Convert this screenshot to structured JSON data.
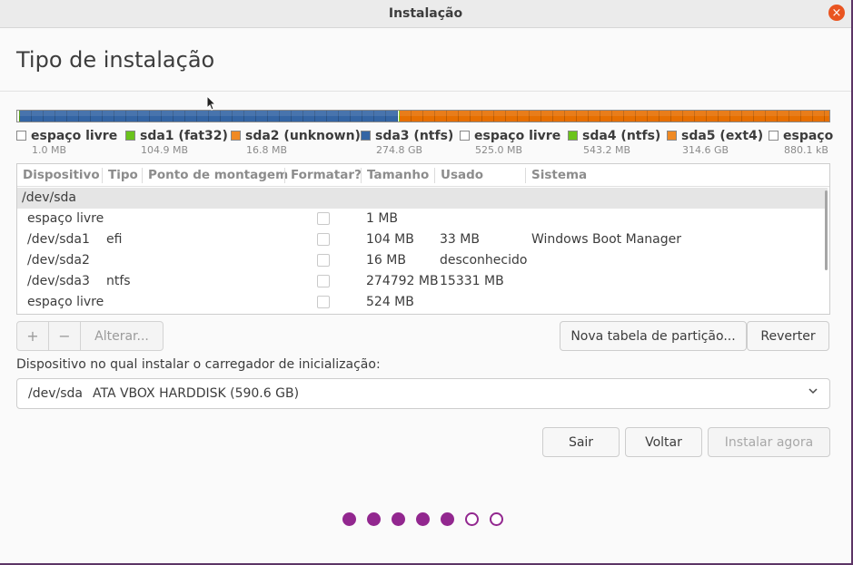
{
  "window": {
    "title": "Instalação",
    "close_icon": "×"
  },
  "heading": "Tipo de instalação",
  "partition_bar": {
    "segments": [
      {
        "name": "espaço livre",
        "color": "#ffffff",
        "fraction": 0.0017
      },
      {
        "name": "sda1",
        "color": "#4e9a06",
        "fraction": 0.0017
      },
      {
        "name": "sda2",
        "color": "#e66f00",
        "fraction": 0.0003
      },
      {
        "name": "sda3",
        "color": "#3465a4",
        "fraction": 0.4653
      },
      {
        "name": "espaço livre",
        "color": "#ffffff",
        "fraction": 0.0009
      },
      {
        "name": "sda4",
        "color": "#73d216",
        "fraction": 0.0009
      },
      {
        "name": "sda5",
        "color": "#e66f00",
        "fraction": 0.5292
      }
    ]
  },
  "legend": [
    {
      "label": "espaço livre",
      "size": "1.0 MB",
      "color": "#ffffff"
    },
    {
      "label": "sda1 (fat32)",
      "size": "104.9 MB",
      "color": "#6bc31c"
    },
    {
      "label": "sda2 (unknown)",
      "size": "16.8 MB",
      "color": "#f08a24"
    },
    {
      "label": "sda3 (ntfs)",
      "size": "274.8 GB",
      "color": "#3465a4"
    },
    {
      "label": "espaço livre",
      "size": "525.0 MB",
      "color": "#ffffff"
    },
    {
      "label": "sda4 (ntfs)",
      "size": "543.2 MB",
      "color": "#6bc31c"
    },
    {
      "label": "sda5 (ext4)",
      "size": "314.6 GB",
      "color": "#f08a24"
    },
    {
      "label": "espaço",
      "size": "880.1 kB",
      "color": "#ffffff"
    }
  ],
  "table": {
    "headers": [
      "Dispositivo",
      "Tipo",
      "Ponto de montagem",
      "Formatar?",
      "Tamanho",
      "Usado",
      "Sistema"
    ],
    "group": "/dev/sda",
    "rows": [
      {
        "device": "espaço livre",
        "type": "",
        "mount": "",
        "size": "1 MB",
        "used": "",
        "system": ""
      },
      {
        "device": "/dev/sda1",
        "type": "efi",
        "mount": "",
        "size": "104 MB",
        "used": "33 MB",
        "system": "Windows Boot Manager"
      },
      {
        "device": "/dev/sda2",
        "type": "",
        "mount": "",
        "size": "16 MB",
        "used": "desconhecido",
        "system": ""
      },
      {
        "device": "/dev/sda3",
        "type": "ntfs",
        "mount": "",
        "size": "274792 MB",
        "used": "15331 MB",
        "system": ""
      },
      {
        "device": "espaço livre",
        "type": "",
        "mount": "",
        "size": "524 MB",
        "used": "",
        "system": ""
      }
    ]
  },
  "partition_buttons": {
    "add": "+",
    "remove": "−",
    "change": "Alterar..."
  },
  "new_table_button": "Nova tabela de partição...",
  "revert_button": "Reverter",
  "bootloader": {
    "label": "Dispositivo no qual instalar o carregador de inicialização:",
    "device": "/dev/sda",
    "description": "ATA VBOX HARDDISK (590.6 GB)"
  },
  "nav": {
    "quit": "Sair",
    "back": "Voltar",
    "install": "Instalar agora"
  },
  "progress": {
    "total_steps": 7,
    "completed_steps": 5,
    "color": "#92278f"
  }
}
